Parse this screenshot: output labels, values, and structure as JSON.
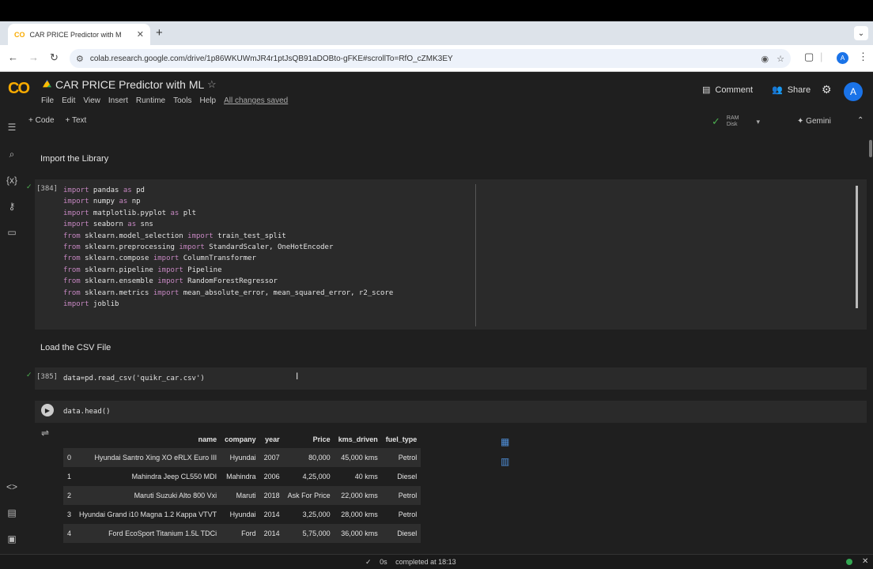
{
  "browser": {
    "tab_title": "CAR PRICE Predictor with M",
    "tab_favicon": "CO",
    "url": "colab.research.google.com/drive/1p86WKUWmJR4r1ptJsQB91aDOBto-gFKE#scrollTo=RfO_cZMK3EY",
    "profile_initial": "A"
  },
  "colab": {
    "logo": "CO",
    "title": "CAR PRICE Predictor with ML",
    "menu": [
      "File",
      "Edit",
      "View",
      "Insert",
      "Runtime",
      "Tools",
      "Help"
    ],
    "save_status": "All changes saved",
    "comment_label": "Comment",
    "share_label": "Share",
    "avatar_initial": "A",
    "add_code": "+ Code",
    "add_text": "+ Text",
    "ram_label": "RAM",
    "disk_label": "Disk",
    "gemini_label": "Gemini"
  },
  "cells": {
    "md1": "Import the Library",
    "md2": "Load the CSV File",
    "cell1_num": "[384]",
    "cell2_num": "[385]",
    "cell2_code": "data=pd.read_csv('quikr_car.csv')",
    "cell3_code": "data.head()"
  },
  "dataframe": {
    "columns": [
      "",
      "name",
      "company",
      "year",
      "Price",
      "kms_driven",
      "fuel_type"
    ],
    "rows": [
      [
        "0",
        "Hyundai Santro Xing XO eRLX Euro III",
        "Hyundai",
        "2007",
        "80,000",
        "45,000 kms",
        "Petrol"
      ],
      [
        "1",
        "Mahindra Jeep CL550 MDI",
        "Mahindra",
        "2006",
        "4,25,000",
        "40 kms",
        "Diesel"
      ],
      [
        "2",
        "Maruti Suzuki Alto 800 Vxi",
        "Maruti",
        "2018",
        "Ask For Price",
        "22,000 kms",
        "Petrol"
      ],
      [
        "3",
        "Hyundai Grand i10 Magna 1.2 Kappa VTVT",
        "Hyundai",
        "2014",
        "3,25,000",
        "28,000 kms",
        "Petrol"
      ],
      [
        "4",
        "Ford EcoSport Titanium 1.5L TDCi",
        "Ford",
        "2014",
        "5,75,000",
        "36,000 kms",
        "Diesel"
      ]
    ]
  },
  "status": {
    "text": "completed at 18:13",
    "check": "✓",
    "exec_time": "0s"
  }
}
